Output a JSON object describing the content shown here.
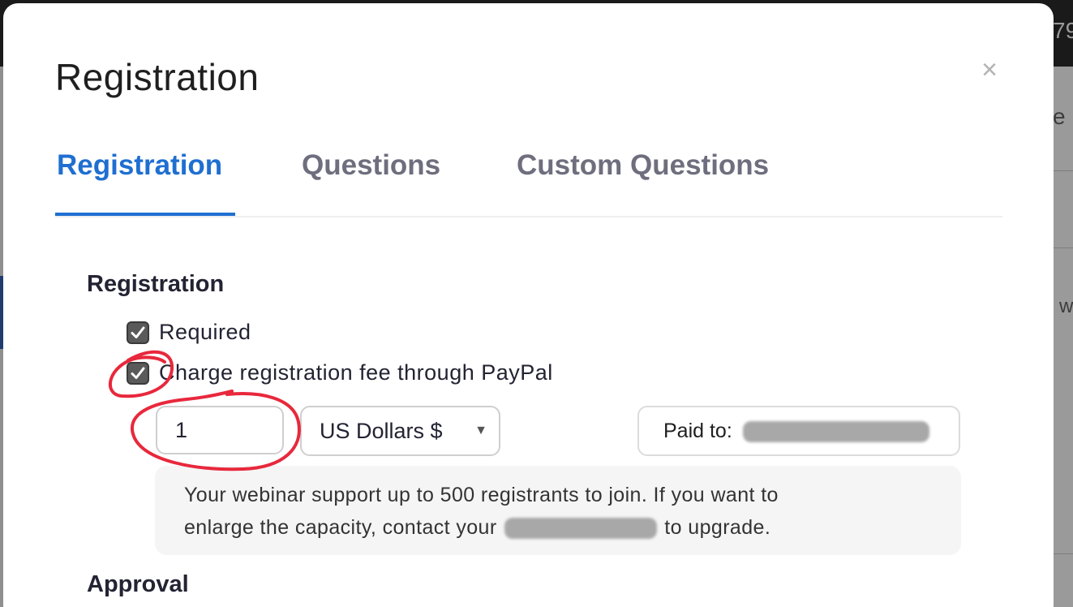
{
  "backdrop": {
    "top_fragment": "79",
    "side_fragment_1": "e",
    "side_fragment_2": "w"
  },
  "modal": {
    "title": "Registration",
    "close_label": "×"
  },
  "tabs": [
    {
      "label": "Registration",
      "active": true
    },
    {
      "label": "Questions",
      "active": false
    },
    {
      "label": "Custom Questions",
      "active": false
    }
  ],
  "registration_section": {
    "title": "Registration",
    "required_label": "Required",
    "required_checked": true,
    "charge_fee_label": "Charge registration fee through PayPal",
    "charge_fee_checked": true,
    "fee_amount": "1",
    "currency": "US Dollars $",
    "paid_to_label": "Paid to:",
    "info_text_line1": "Your webinar support up to 500 registrants to join. If you want to",
    "info_text_line2_start": "enlarge the capacity, contact your",
    "info_text_line2_end": "to upgrade."
  },
  "approval_section": {
    "title": "Approval"
  },
  "colors": {
    "accent": "#1f6fd1",
    "annotation": "#e8283c",
    "tab_inactive": "#6e6e7e"
  }
}
